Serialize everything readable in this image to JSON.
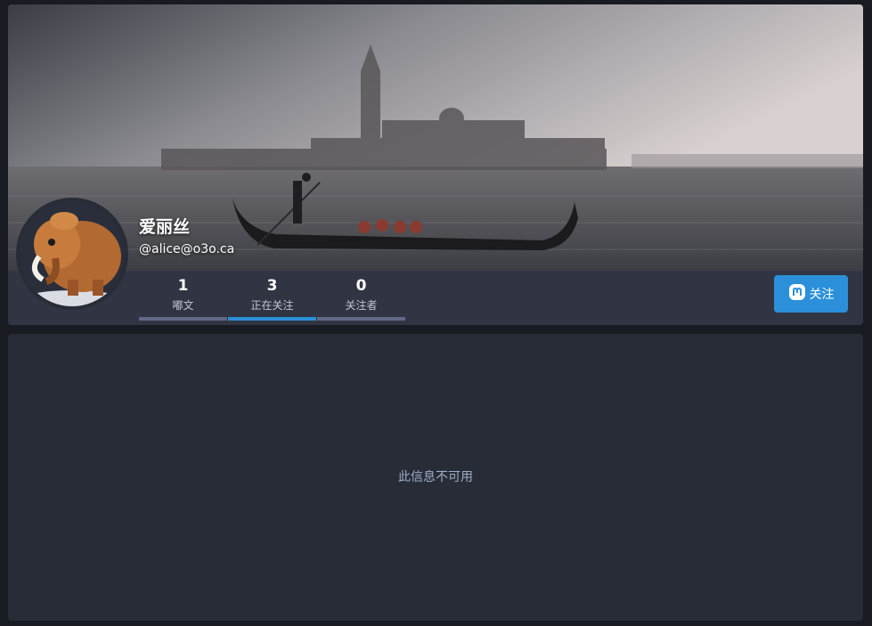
{
  "profile": {
    "display_name": "爱丽丝",
    "handle": "@alice@o3o.ca"
  },
  "tabs": [
    {
      "count": "1",
      "label": "嘟文"
    },
    {
      "count": "3",
      "label": "正在关注"
    },
    {
      "count": "0",
      "label": "关注者"
    }
  ],
  "follow_button": {
    "label": "关注",
    "icon": "mastodon-icon",
    "color": "#2b90d9"
  },
  "notice": "此信息不可用",
  "colors": {
    "accent": "#2b90d9",
    "card": "#313543",
    "panel": "#282c37",
    "background": "#191b22"
  }
}
